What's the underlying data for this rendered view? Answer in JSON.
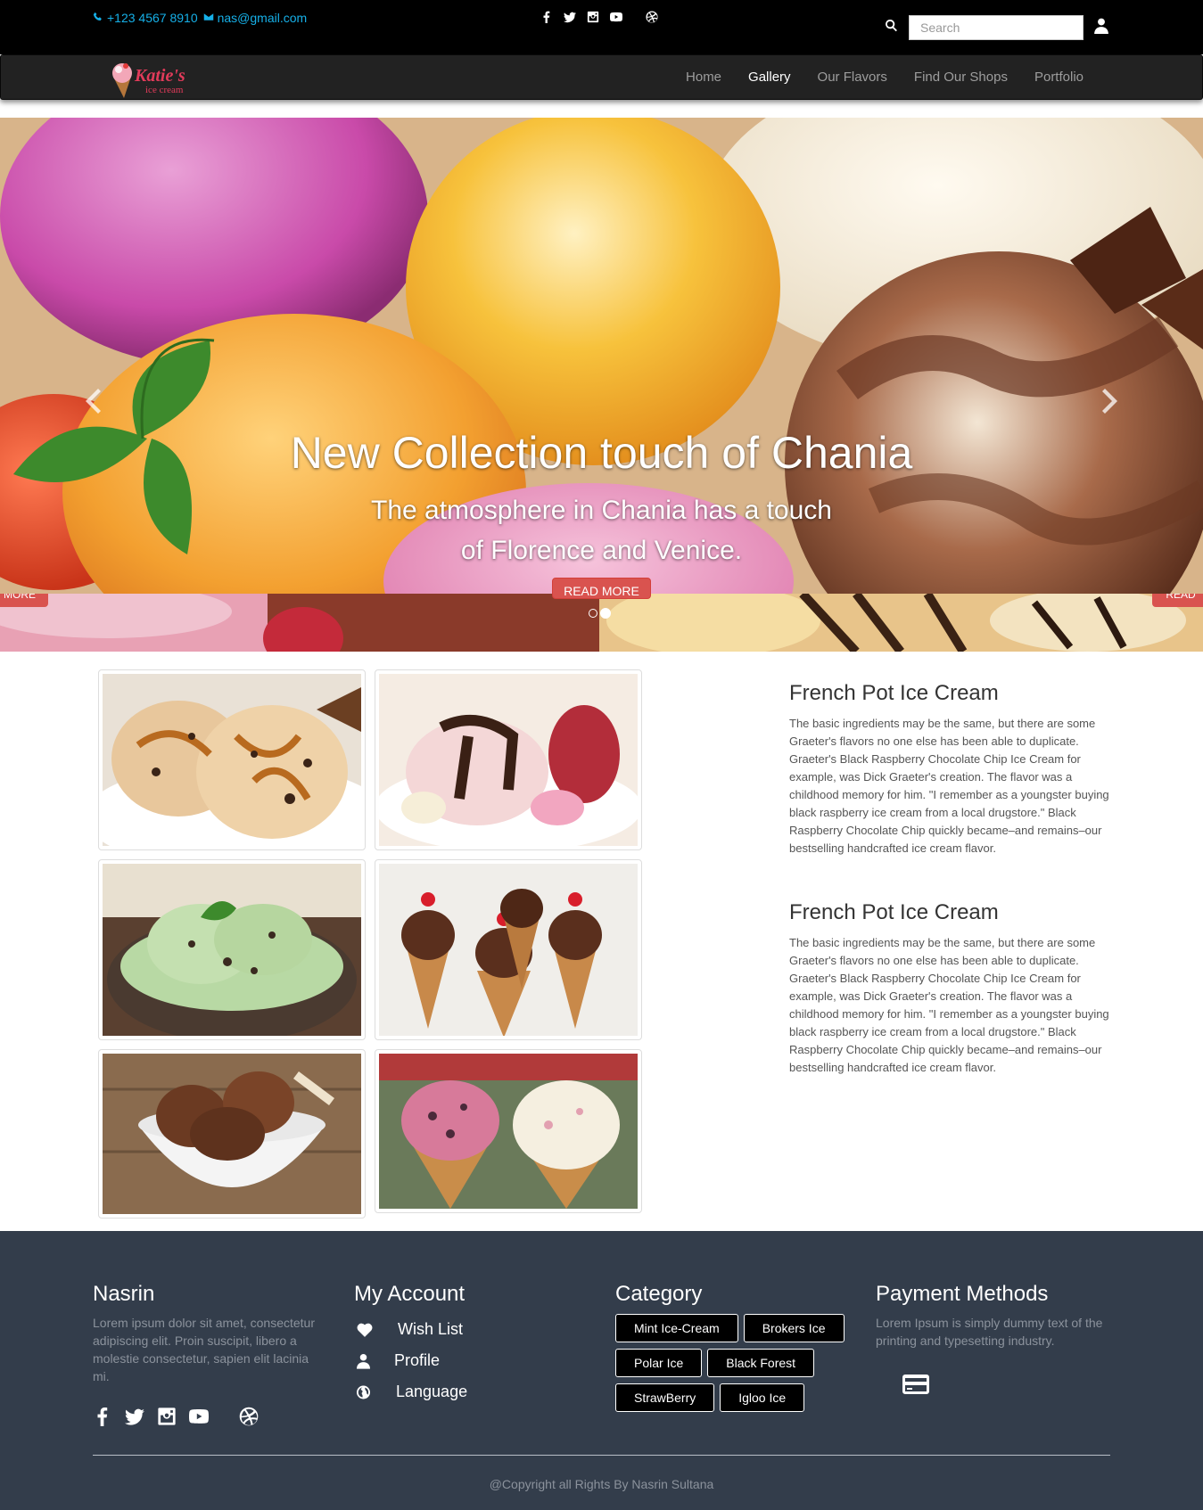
{
  "topbar": {
    "phone": "+123 4567 8910",
    "email": "nas@gmail.com",
    "social_icons": [
      "facebook-icon",
      "twitter-icon",
      "instagram-icon",
      "youtube-icon",
      "dribbble-icon"
    ],
    "search_placeholder": "Search"
  },
  "navbar": {
    "logo_text": "Katie's",
    "logo_subtext": "ice cream",
    "items": [
      {
        "label": "Home",
        "active": false
      },
      {
        "label": "Gallery",
        "active": true
      },
      {
        "label": "Our Flavors",
        "active": false
      },
      {
        "label": "Find Our Shops",
        "active": false
      },
      {
        "label": "Portfolio",
        "active": false
      }
    ]
  },
  "carousel": {
    "title": "New Collection touch of Chania",
    "text_line1": "The atmosphere in Chania has a touch",
    "text_line2": "of Florence and Venice.",
    "button_label": "READ MORE",
    "ghost_left": "MORE",
    "ghost_right": "READ",
    "slide_count": 2,
    "active_slide": 2
  },
  "gallery": {
    "images": [
      "caramel-ice-cream",
      "strawberry-sundae",
      "mint-chip-bowl",
      "chocolate-cones",
      "chocolate-bowl",
      "waffle-cones"
    ]
  },
  "articles": [
    {
      "title": "French Pot Ice Cream",
      "body": "The basic ingredients may be the same, but there are some Graeter's flavors no one else has been able to duplicate. Graeter's Black Raspberry Chocolate Chip Ice Cream for example, was Dick Graeter's creation. The flavor was a childhood memory for him. \"I remember as a youngster buying black raspberry ice cream from a local drugstore.\" Black Raspberry Chocolate Chip quickly became–and remains–our bestselling handcrafted ice cream flavor."
    },
    {
      "title": "French Pot Ice Cream",
      "body": "The basic ingredients may be the same, but there are some Graeter's flavors no one else has been able to duplicate. Graeter's Black Raspberry Chocolate Chip Ice Cream for example, was Dick Graeter's creation. The flavor was a childhood memory for him. \"I remember as a youngster buying black raspberry ice cream from a local drugstore.\" Black Raspberry Chocolate Chip quickly became–and remains–our bestselling handcrafted ice cream flavor."
    }
  ],
  "footer": {
    "about": {
      "title": "Nasrin",
      "text": "Lorem ipsum dolor sit amet, consectetur adipiscing elit. Proin suscipit, libero a molestie consectetur, sapien elit lacinia mi."
    },
    "account": {
      "title": "My Account",
      "items": [
        {
          "label": "Wish List",
          "icon": "heart-icon"
        },
        {
          "label": "Profile",
          "icon": "user-icon"
        },
        {
          "label": "Language",
          "icon": "globe-icon"
        }
      ]
    },
    "category": {
      "title": "Category",
      "tags": [
        "Mint Ice-Cream",
        "Brokers Ice",
        "Polar Ice",
        "Black Forest",
        "StrawBerry",
        "Igloo Ice"
      ]
    },
    "payment": {
      "title": "Payment Methods",
      "text": "Lorem Ipsum is simply dummy text of the printing and typesetting industry.",
      "icon": "credit-card-icon"
    },
    "copyright": "@Copyright all Rights By Nasrin Sultana"
  },
  "colors": {
    "topbar_bg": "#000000",
    "contact_text": "#16b0e8",
    "navbar_bg": "#222222",
    "footer_bg": "#333d4b",
    "button_red": "#d9534f"
  }
}
